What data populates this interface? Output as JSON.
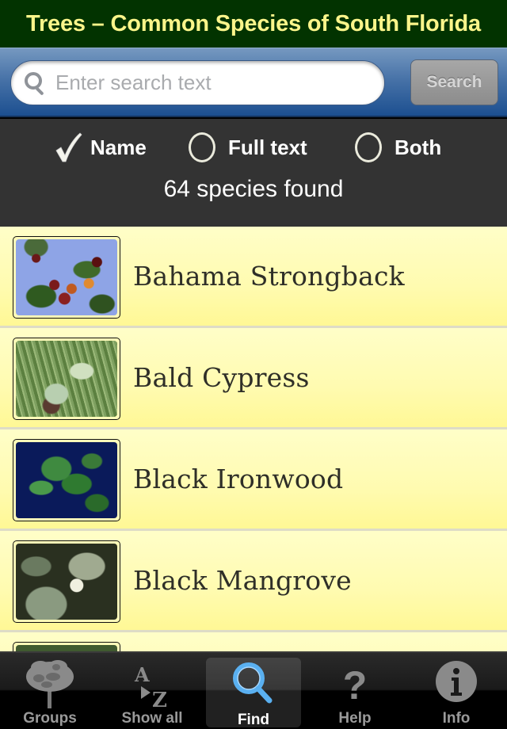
{
  "header": {
    "title": "Trees – Common Species of South Florida"
  },
  "search": {
    "placeholder": "Enter search text",
    "value": "",
    "button_label": "Search",
    "icon": "search-icon"
  },
  "filter": {
    "options": [
      {
        "label": "Name",
        "selected": true,
        "icon": "check-icon"
      },
      {
        "label": "Full text",
        "selected": false,
        "icon": "radio-icon"
      },
      {
        "label": "Both",
        "selected": false,
        "icon": "radio-icon"
      }
    ],
    "result_count": "64 species found"
  },
  "species": [
    {
      "name": "Bahama Strongback"
    },
    {
      "name": "Bald Cypress"
    },
    {
      "name": "Black Ironwood"
    },
    {
      "name": "Black Mangrove"
    },
    {
      "name": ""
    }
  ],
  "tabs": [
    {
      "label": "Groups",
      "icon": "tree-icon",
      "active": false
    },
    {
      "label": "Show all",
      "icon": "a-to-z-icon",
      "active": false
    },
    {
      "label": "Find",
      "icon": "magnifier-icon",
      "active": true
    },
    {
      "label": "Help",
      "icon": "question-icon",
      "active": false
    },
    {
      "label": "Info",
      "icon": "info-icon",
      "active": false
    }
  ],
  "colors": {
    "title_bg": "#023300",
    "title_text": "#fbf58a",
    "search_bar": "#1c4f90",
    "options_bg": "#333333",
    "list_bg": "#fffbb0",
    "active_tab_icon": "#5ab0f0"
  }
}
